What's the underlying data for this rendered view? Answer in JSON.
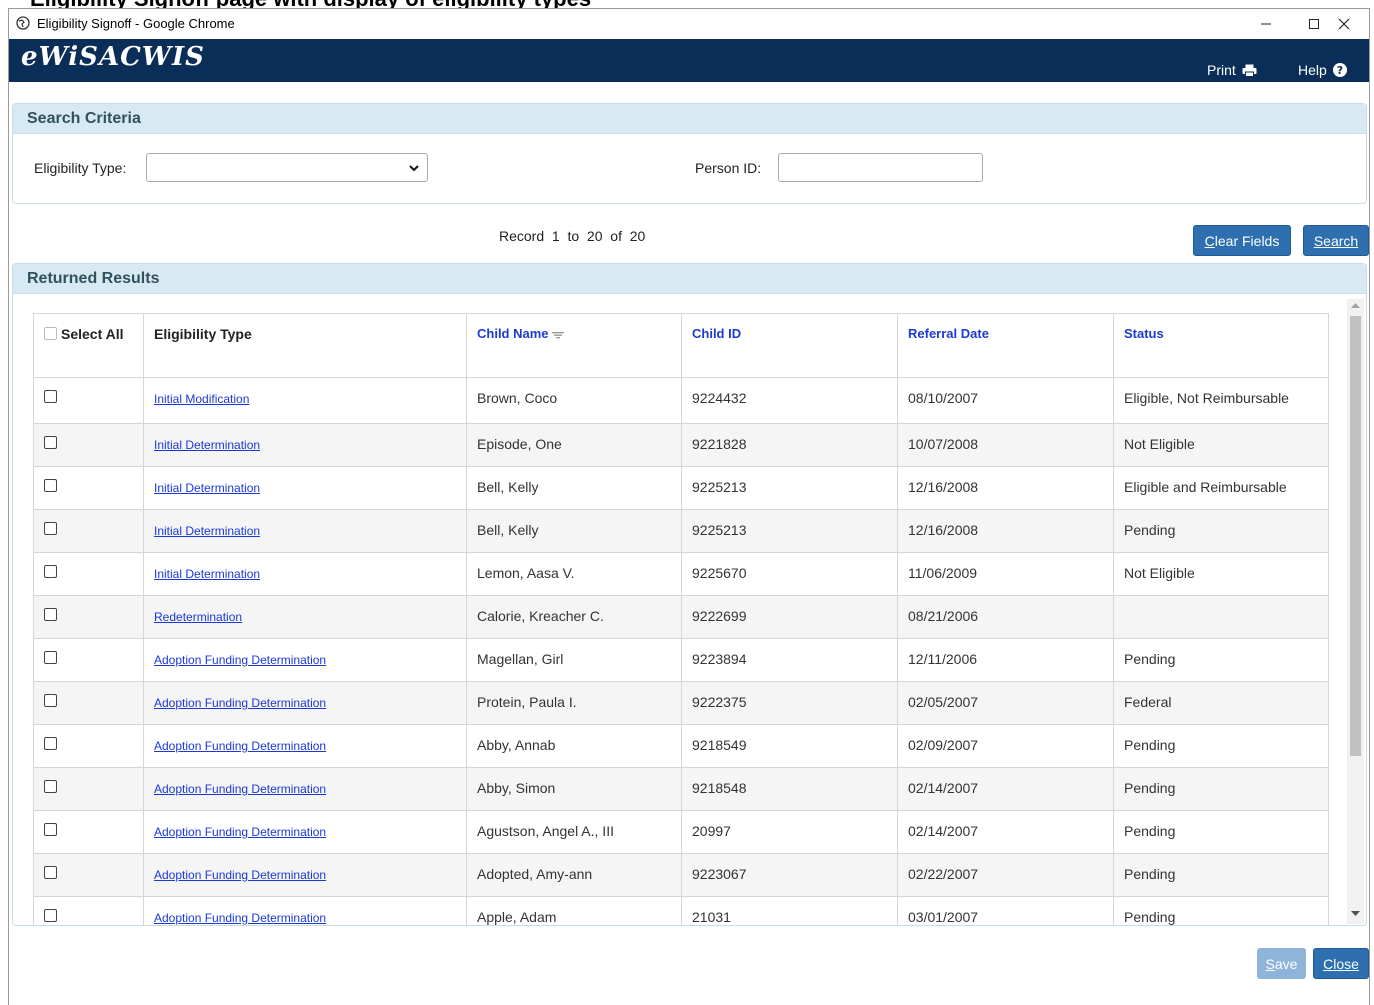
{
  "document_heading": "Eligibility Signoff page with display of eligibility types",
  "window": {
    "title": "Eligibility Signoff - Google Chrome",
    "controls": {
      "minimize": "–",
      "maximize": "☐",
      "close": "✕"
    }
  },
  "app": {
    "logo": "eWiSACWIS",
    "print_label": "Print",
    "help_label": "Help"
  },
  "search": {
    "panel_title": "Search Criteria",
    "eligibility_type_label": "Eligibility Type:",
    "eligibility_type_value": "",
    "person_id_label": "Person ID:",
    "person_id_value": ""
  },
  "record_info": "Record  1  to  20  of  20",
  "buttons": {
    "clear_fields_hot": "C",
    "clear_fields_rest": "lear Fields",
    "search_hot": "S",
    "search_rest": "earch",
    "save_hot": "S",
    "save_rest": "ave",
    "close_hot": "C",
    "close_rest": "lose"
  },
  "results": {
    "panel_title": "Returned Results",
    "columns": {
      "select_all": "Select All",
      "eligibility_type": "Eligibility Type",
      "child_name": "Child Name",
      "child_id": "Child ID",
      "referral_date": "Referral Date",
      "status": "Status"
    },
    "rows": [
      {
        "eligibility_type": "Initial Modification",
        "child_name": "Brown, Coco",
        "child_id": "9224432",
        "referral_date": "08/10/2007",
        "status": "Eligible, Not Reimbursable"
      },
      {
        "eligibility_type": "Initial Determination",
        "child_name": "Episode, One",
        "child_id": "9221828",
        "referral_date": "10/07/2008",
        "status": "Not Eligible"
      },
      {
        "eligibility_type": "Initial Determination",
        "child_name": "Bell, Kelly",
        "child_id": "9225213",
        "referral_date": "12/16/2008",
        "status": "Eligible and Reimbursable"
      },
      {
        "eligibility_type": "Initial Determination",
        "child_name": "Bell, Kelly",
        "child_id": "9225213",
        "referral_date": "12/16/2008",
        "status": "Pending"
      },
      {
        "eligibility_type": "Initial Determination",
        "child_name": "Lemon, Aasa V.",
        "child_id": "9225670",
        "referral_date": "11/06/2009",
        "status": "Not Eligible"
      },
      {
        "eligibility_type": "Redetermination",
        "child_name": "Calorie, Kreacher C.",
        "child_id": "9222699",
        "referral_date": "08/21/2006",
        "status": ""
      },
      {
        "eligibility_type": "Adoption Funding Determination",
        "child_name": "Magellan, Girl",
        "child_id": "9223894",
        "referral_date": "12/11/2006",
        "status": "Pending"
      },
      {
        "eligibility_type": "Adoption Funding Determination",
        "child_name": "Protein, Paula I.",
        "child_id": "9222375",
        "referral_date": "02/05/2007",
        "status": "Federal"
      },
      {
        "eligibility_type": "Adoption Funding Determination",
        "child_name": "Abby, Annab",
        "child_id": "9218549",
        "referral_date": "02/09/2007",
        "status": "Pending"
      },
      {
        "eligibility_type": "Adoption Funding Determination",
        "child_name": "Abby, Simon",
        "child_id": "9218548",
        "referral_date": "02/14/2007",
        "status": "Pending"
      },
      {
        "eligibility_type": "Adoption Funding Determination",
        "child_name": "Agustson, Angel A., III",
        "child_id": "20997",
        "referral_date": "02/14/2007",
        "status": "Pending"
      },
      {
        "eligibility_type": "Adoption Funding Determination",
        "child_name": "Adopted, Amy-ann",
        "child_id": "9223067",
        "referral_date": "02/22/2007",
        "status": "Pending"
      },
      {
        "eligibility_type": "Adoption Funding Determination",
        "child_name": "Apple, Adam",
        "child_id": "21031",
        "referral_date": "03/01/2007",
        "status": "Pending"
      }
    ]
  },
  "colors": {
    "header_navy": "#0a2e57",
    "panel_head_bg": "#d7e9f3",
    "button_blue": "#2e6fb0",
    "link_blue": "#1b38d8"
  }
}
